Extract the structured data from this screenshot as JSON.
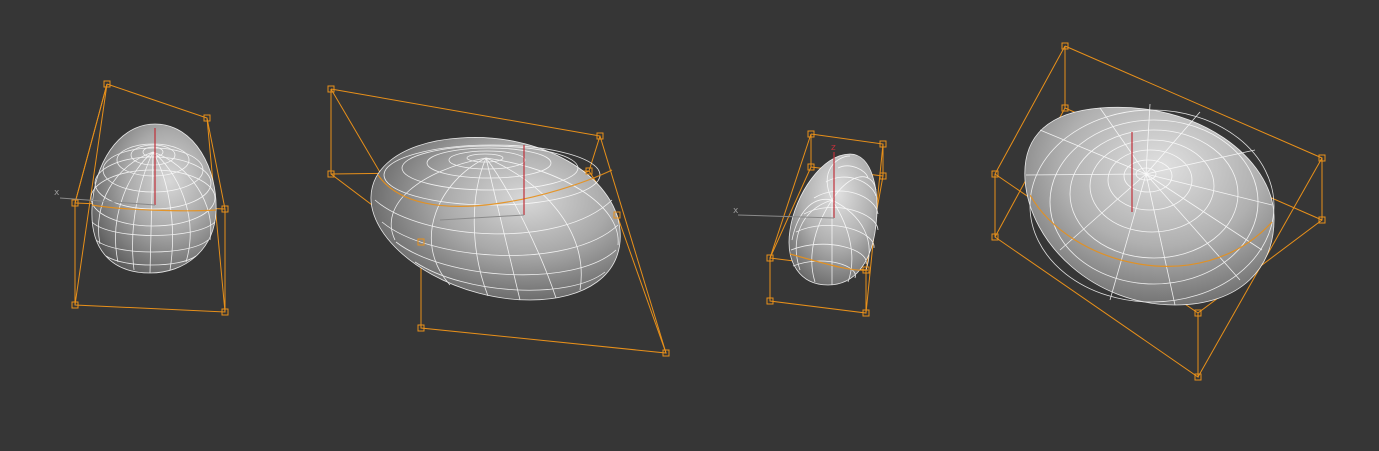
{
  "viewport": {
    "background": "#363636",
    "lattice_color": "#e8901a",
    "wire_color": "#ffffff",
    "z_axis_color": "#c0303a",
    "x_axis_color": "#8a8a8a"
  },
  "axis_labels": {
    "x": "x",
    "z": "z"
  },
  "objects": [
    {
      "id": "egg-1",
      "type": "ffd-deformed-ellipsoid"
    },
    {
      "id": "egg-2",
      "type": "ffd-deformed-ellipsoid"
    },
    {
      "id": "egg-3",
      "type": "ffd-deformed-ellipsoid"
    },
    {
      "id": "egg-4",
      "type": "ffd-deformed-ellipsoid"
    }
  ]
}
